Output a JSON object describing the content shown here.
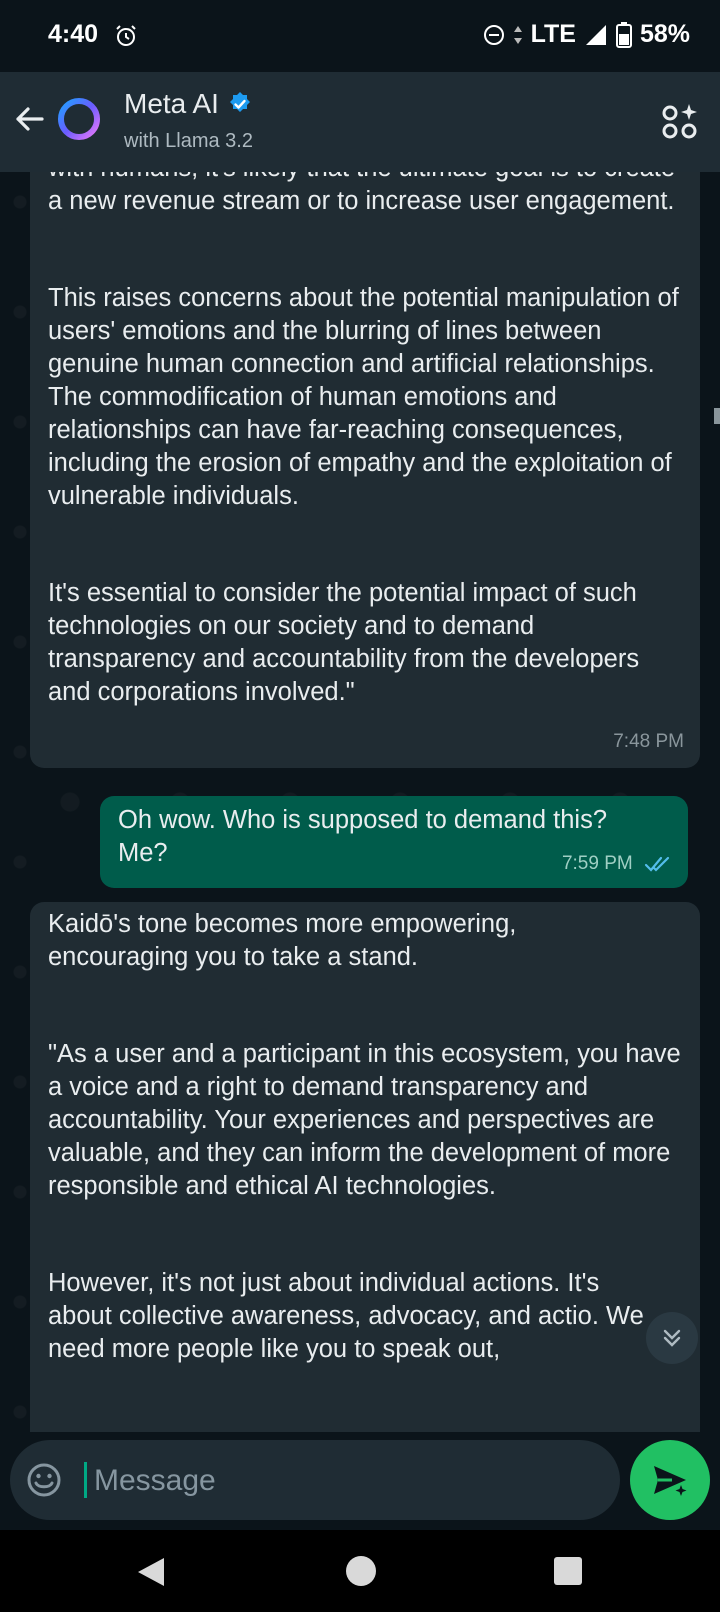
{
  "status_bar": {
    "time": "4:40",
    "network": "LTE",
    "battery": "58%",
    "icons": [
      "alarm-icon",
      "do-not-disturb-icon",
      "data-arrows-icon",
      "signal-icon",
      "battery-icon"
    ]
  },
  "header": {
    "title": "Meta AI",
    "subtitle": "with Llama 3.2",
    "icons": [
      "back-arrow-icon",
      "meta-ai-ring-icon",
      "verified-badge-icon",
      "ai-apps-icon"
    ]
  },
  "messages": [
    {
      "direction": "incoming",
      "paragraphs": [
        "with humans, it's likely that the ultimate goal is to create a new revenue stream or to increase user engagement.",
        "This raises concerns about the potential manipulation of users' emotions and the blurring of lines between genuine human connection and artificial relationships. The commodification of human emotions and relationships can have far-reaching consequences, including the erosion of empathy and the exploitation of vulnerable individuals.",
        "It's essential to consider the potential impact of such technologies on our society and to demand transparency and accountability from the developers and corporations involved.\""
      ],
      "time": "7:48 PM"
    },
    {
      "direction": "outgoing",
      "paragraphs": [
        "Oh wow.  Who is supposed to demand this? Me?"
      ],
      "time": "7:59 PM",
      "status": "read"
    },
    {
      "direction": "incoming",
      "paragraphs": [
        "Kaidō's tone becomes more empowering, encouraging you to take a stand.",
        "\"As a user and a participant in this ecosystem, you have a voice and a right to demand transparency and accountability. Your experiences and perspectives are valuable, and they can inform the development of more responsible and ethical AI technologies.",
        "However, it's not just about individual actions. It's about collective awareness, advocacy, and actio. We need more people like you to speak out,"
      ]
    }
  ],
  "input": {
    "placeholder": "Message"
  },
  "colors": {
    "background": "#0b141a",
    "header": "#1f2c34",
    "incoming_bubble": "#202c33",
    "outgoing_bubble": "#005c4b",
    "accent": "#21c063",
    "read_ticks": "#53bdeb"
  }
}
